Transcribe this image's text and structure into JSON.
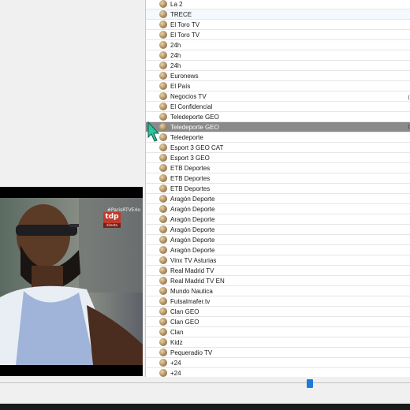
{
  "channels": [
    {
      "name": "La 2"
    },
    {
      "name": "TRECE"
    },
    {
      "name": "El Toro TV"
    },
    {
      "name": "El Toro TV"
    },
    {
      "name": "24h"
    },
    {
      "name": "24h"
    },
    {
      "name": "24h"
    },
    {
      "name": "Euronews"
    },
    {
      "name": "El País"
    },
    {
      "name": "Negocios TV"
    },
    {
      "name": "El Confidencial"
    },
    {
      "name": "Teledeporte GEO"
    },
    {
      "name": "Teledeporte GEO"
    },
    {
      "name": "Teledeporte"
    },
    {
      "name": "Esport 3 GEO CAT"
    },
    {
      "name": "Esport 3 GEO"
    },
    {
      "name": "ETB Deportes"
    },
    {
      "name": "ETB Deportes"
    },
    {
      "name": "ETB Deportes"
    },
    {
      "name": "Aragón Deporte"
    },
    {
      "name": "Aragón Deporte"
    },
    {
      "name": "Aragón Deporte"
    },
    {
      "name": "Aragón Deporte"
    },
    {
      "name": "Aragón Deporte"
    },
    {
      "name": "Aragón Deporte"
    },
    {
      "name": "Vinx TV Asturias"
    },
    {
      "name": "Real Madrid TV"
    },
    {
      "name": "Real Madrid TV EN"
    },
    {
      "name": "Mundo Nautica"
    },
    {
      "name": "Futsalmafer.tv"
    },
    {
      "name": "Clan GEO"
    },
    {
      "name": "Clan GEO"
    },
    {
      "name": "Clan"
    },
    {
      "name": "Kidz"
    },
    {
      "name": "Pequeradio TV"
    },
    {
      "name": "+24"
    },
    {
      "name": "+24"
    }
  ],
  "selected_index": 12,
  "highlight_index": 1,
  "video": {
    "hashtag": "#ParisRTVE4o",
    "logo": "tdp",
    "live": "directo"
  },
  "colors": {
    "selected_row": "#8a8a8a",
    "slider_thumb": "#1e7ad8",
    "cursor": "#2ec4a0"
  },
  "icons": {
    "channel": "globe-ball-icon",
    "pointer": "cursor-arrow-icon"
  },
  "slider": {
    "position_fraction": 0.75
  }
}
